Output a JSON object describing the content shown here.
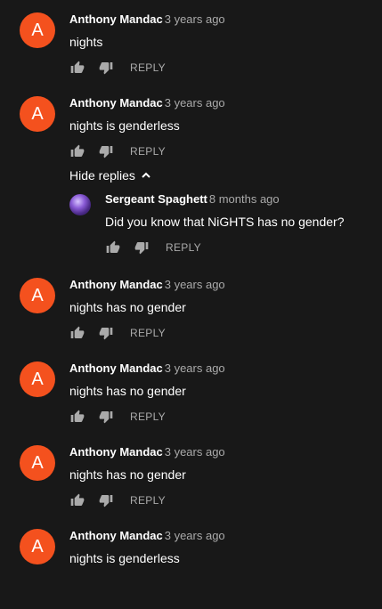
{
  "comments": [
    {
      "avatar_letter": "A",
      "author": "Anthony Mandac",
      "time": "3 years ago",
      "text": "nights",
      "reply_label": "REPLY"
    },
    {
      "avatar_letter": "A",
      "author": "Anthony Mandac",
      "time": "3 years ago",
      "text": "nights is genderless",
      "reply_label": "REPLY"
    },
    {
      "avatar_letter": "A",
      "author": "Anthony Mandac",
      "time": "3 years ago",
      "text": "nights has no gender",
      "reply_label": "REPLY"
    },
    {
      "avatar_letter": "A",
      "author": "Anthony Mandac",
      "time": "3 years ago",
      "text": "nights has no gender",
      "reply_label": "REPLY"
    },
    {
      "avatar_letter": "A",
      "author": "Anthony Mandac",
      "time": "3 years ago",
      "text": "nights has no gender",
      "reply_label": "REPLY"
    },
    {
      "avatar_letter": "A",
      "author": "Anthony Mandac",
      "time": "3 years ago",
      "text": "nights is genderless",
      "reply_label": ""
    }
  ],
  "thread": {
    "hide_replies_label": "Hide replies"
  },
  "reply": {
    "author": "Sergeant Spaghett",
    "time": "8 months ago",
    "text": "Did you know that NiGHTS has no gender?",
    "reply_label": "REPLY"
  },
  "colors": {
    "background": "#181818",
    "avatar": "#f4511e",
    "secondary_text": "#aaaaaa"
  }
}
